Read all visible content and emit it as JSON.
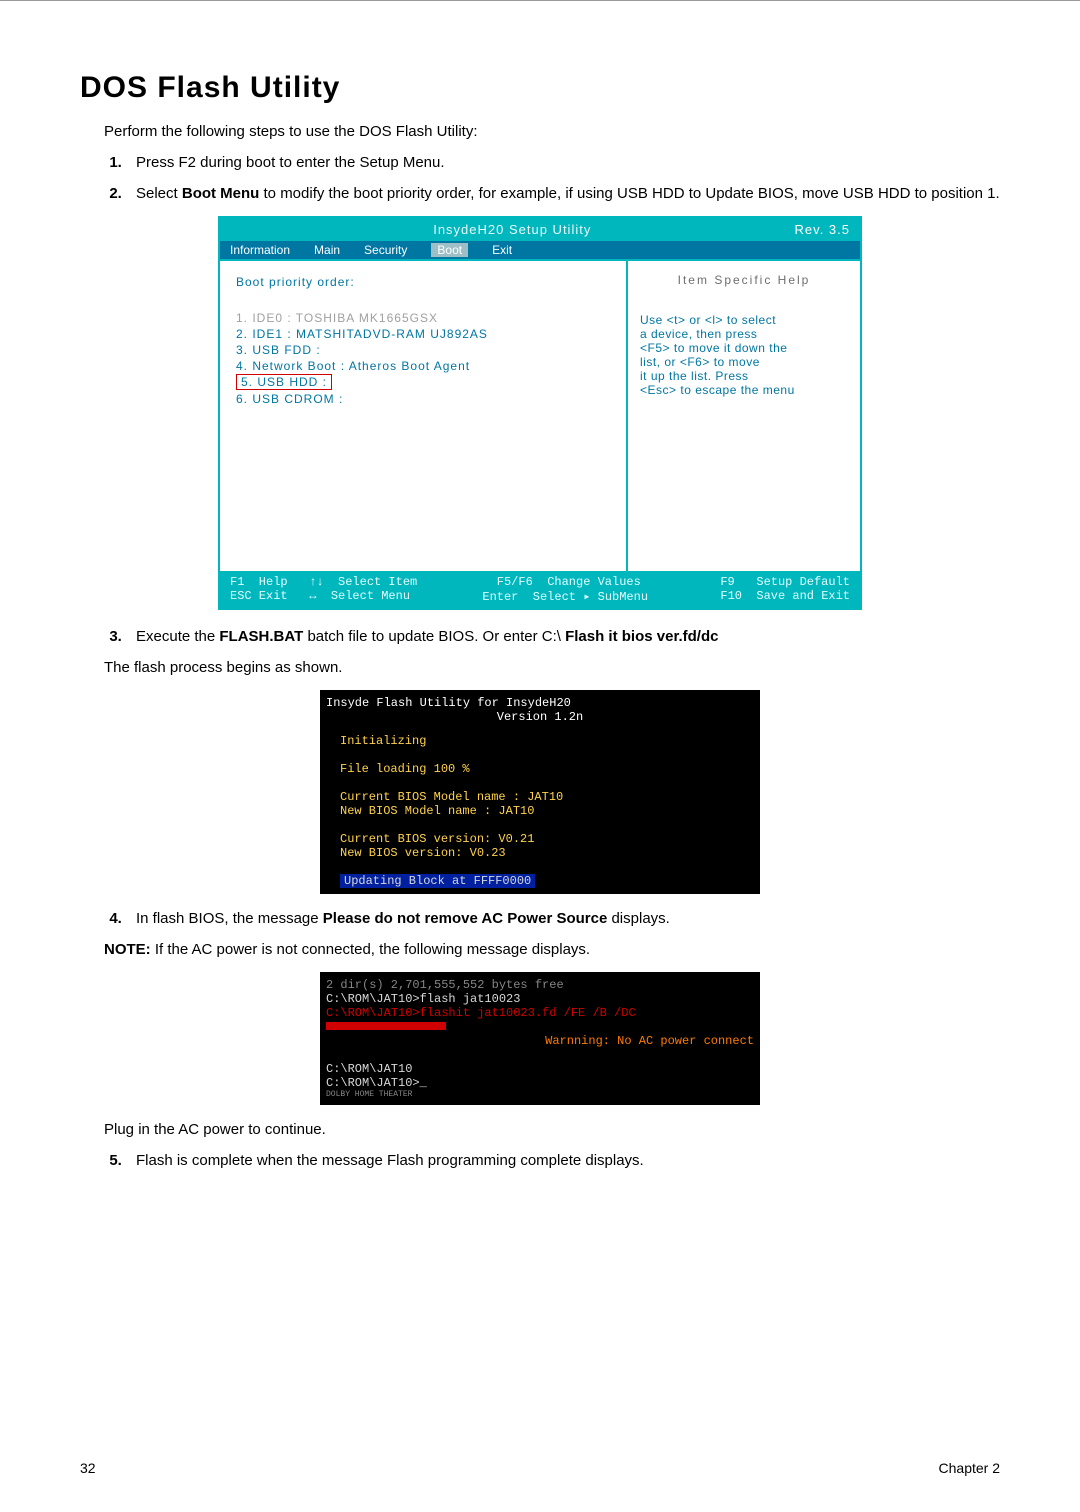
{
  "heading": "DOS Flash Utility",
  "intro": "Perform the following steps to use the DOS Flash Utility:",
  "steps": {
    "s1": "Press F2 during boot to enter the Setup Menu.",
    "s2a": "Select ",
    "s2b": "Boot Menu",
    "s2c": " to modify the boot priority order, for example, if using USB HDD to Update BIOS, move USB HDD to position 1.",
    "s3a": "Execute the ",
    "s3b": "FLASH.BAT",
    "s3c": " batch file to update BIOS. Or enter C:\\ ",
    "s3d": "Flash it bios ver.fd/dc",
    "s4a": "In flash BIOS, the message ",
    "s4b": "Please do not remove AC Power Source",
    "s4c": " displays.",
    "s5": "Flash is complete when the message Flash programming complete displays."
  },
  "para1": "The flash process begins as shown.",
  "note_a": "NOTE:",
  "note_b": " If the AC power is not connected, the following message displays.",
  "para2": "Plug in the AC power to continue.",
  "bios": {
    "title": "InsydeH20 Setup Utility",
    "rev": "Rev. 3.5",
    "tabs": [
      "Information",
      "Main",
      "Security",
      "Boot",
      "Exit"
    ],
    "left_label": "Boot priority order:",
    "items": [
      "1. IDE0 : TOSHIBA MK1665GSX",
      "2. IDE1 : MATSHITADVD-RAM UJ892AS",
      "3. USB FDD :",
      "4. Network Boot : Atheros Boot Agent",
      "5. USB HDD :",
      "6. USB CDROM :"
    ],
    "help_title": "Item  Specific  Help",
    "help_lines": [
      "Use <t> or <l> to select",
      "a device, then press",
      "<F5> to move it down the",
      "list, or <F6> to move",
      "it up the list. Press",
      "<Esc> to escape the menu"
    ],
    "foot": {
      "c1": "F1  Help   ↑↓  Select Item",
      "c2": "F5/F6  Change Values",
      "c3": "F9   Setup Default",
      "c4": "ESC Exit   ↔  Select Menu",
      "c5": "Enter  Select ▸ SubMenu",
      "c6": "F10  Save and Exit"
    }
  },
  "term1": {
    "title": "Insyde Flash Utility for InsydeH20",
    "ver": "Version 1.2n",
    "l1": "Initializing",
    "l2": "File loading   100 %",
    "l3": "Current BIOS Model name : JAT10",
    "l4": "New     BIOS Model name : JAT10",
    "l5": "Current BIOS version: V0.21",
    "l6": "New     BIOS version: V0.23",
    "l7": "Updating Block at FFFF0000"
  },
  "term2": {
    "l0": "  2 dir(s)   2,701,555,552 bytes free",
    "l1": "C:\\ROM\\JAT10>flash jat10023",
    "l2": "C:\\ROM\\JAT10>flashit jat10023.fd /FE /B /DC",
    "warn": "Warnning: No AC power connect",
    "l3": "C:\\ROM\\JAT10",
    "l4": "C:\\ROM\\JAT10>_",
    "small": "DOLBY HOME THEATER"
  },
  "footer": {
    "page": "32",
    "chapter": "Chapter 2"
  }
}
